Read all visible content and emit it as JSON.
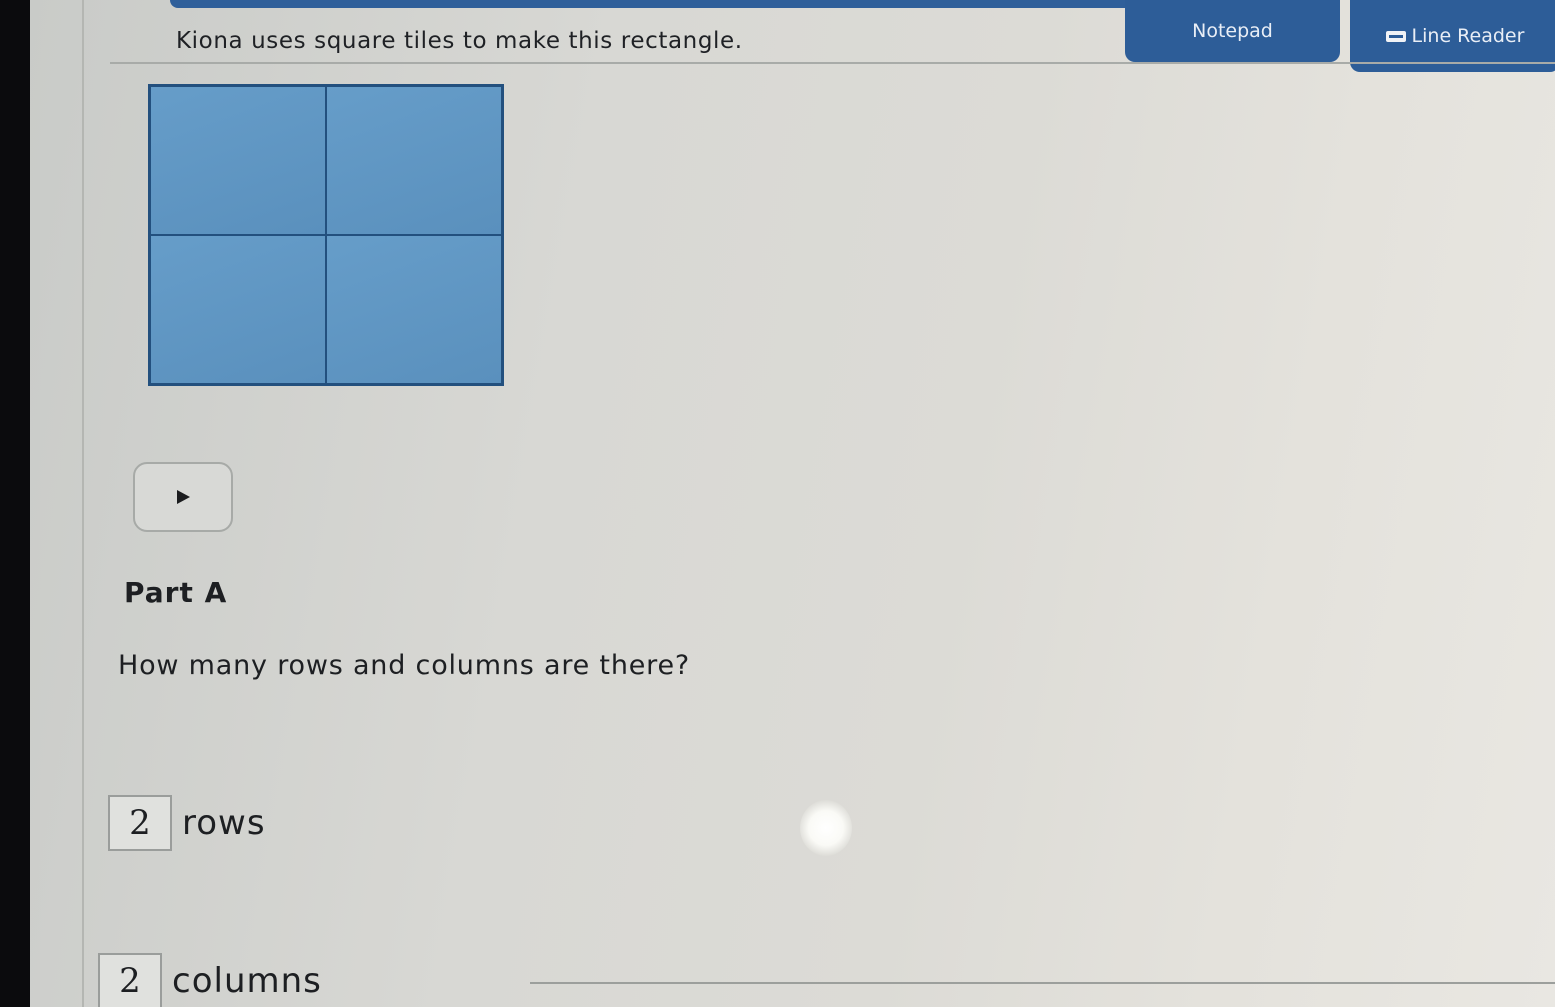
{
  "toolbar": {
    "notepad_label": "Notepad",
    "line_reader_label": "Line Reader"
  },
  "question": {
    "prompt": "Kiona uses square tiles to make this rectangle.",
    "figure": {
      "rows": 2,
      "columns": 2,
      "fill_color": "#5e95c2",
      "line_color": "#23507e"
    },
    "part_heading": "Part A",
    "part_question": "How many rows and columns are there?",
    "answers": {
      "rows_value": "2",
      "rows_label": "rows",
      "columns_value": "2",
      "columns_label": "columns"
    }
  },
  "icons": {
    "play": "play-icon",
    "line_reader": "line-reader-icon"
  }
}
